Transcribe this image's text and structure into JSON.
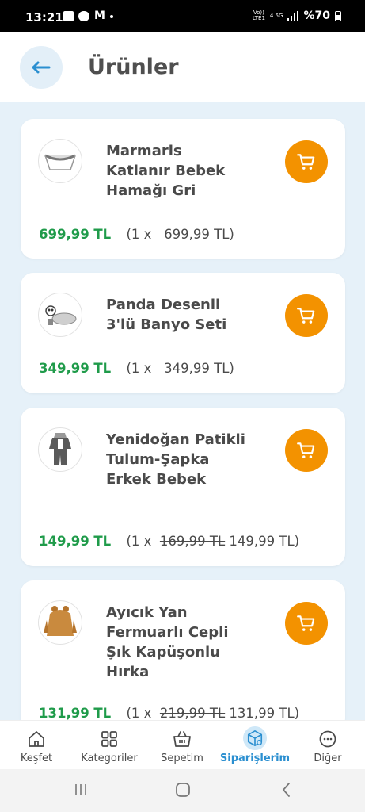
{
  "status_bar": {
    "time": "13:21",
    "network_top": "Vo))",
    "network_bottom": "LTE1",
    "net_type": "4.5G",
    "battery": "%70"
  },
  "header": {
    "title": "Ürünler"
  },
  "products": [
    {
      "name": "Marmaris Katlanır Bebek Hamağı Gri",
      "total": "699,99 TL",
      "qty": "(1 x",
      "old_price": "",
      "unit_price": "699,99 TL)"
    },
    {
      "name": "Panda Desenli 3'lü Banyo Seti",
      "total": "349,99 TL",
      "qty": "(1 x",
      "old_price": "",
      "unit_price": "349,99 TL)"
    },
    {
      "name": "Yenidoğan Patikli Tulum-Şapka Erkek Bebek",
      "total": "149,99 TL",
      "qty": "(1 x",
      "old_price": "169,99 TL",
      "unit_price": "149,99 TL)"
    },
    {
      "name": "Ayıcık Yan Fermuarlı Cepli Şık Kapüşonlu Hırka",
      "total": "131,99 TL",
      "qty": "(1 x",
      "old_price": "219,99 TL",
      "unit_price": "131,99 TL)"
    }
  ],
  "nav": [
    {
      "label": "Keşfet",
      "icon": "home-icon"
    },
    {
      "label": "Kategoriler",
      "icon": "grid-icon"
    },
    {
      "label": "Sepetim",
      "icon": "basket-icon"
    },
    {
      "label": "Siparişlerim",
      "icon": "orders-box-icon",
      "active": true
    },
    {
      "label": "Diğer",
      "icon": "more-icon"
    }
  ],
  "colors": {
    "accent_orange": "#f39200",
    "price_green": "#1f9b4a",
    "active_blue": "#2b8fd0",
    "page_bg": "#e6f1f9"
  }
}
